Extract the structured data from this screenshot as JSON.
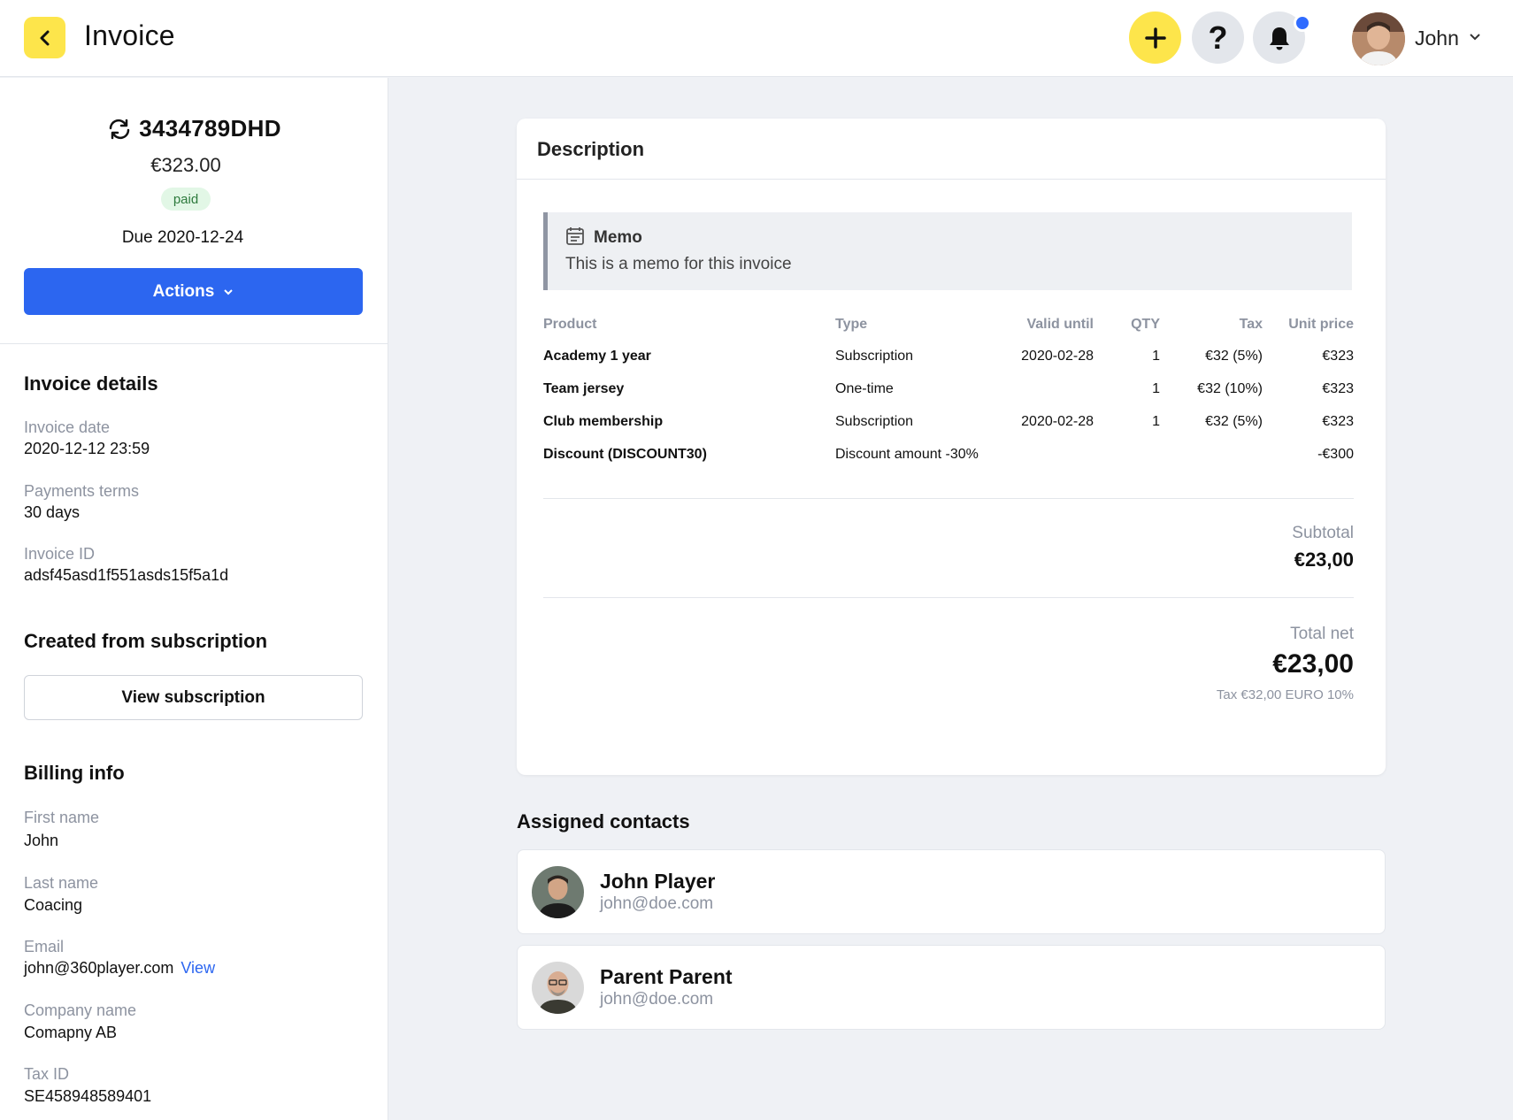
{
  "header": {
    "title": "Invoice",
    "user_name": "John",
    "colors": {
      "accent_yellow": "#fde54b",
      "notification_dot": "#2f6bff"
    }
  },
  "summary": {
    "invoice_number": "3434789DHD",
    "amount": "€323.00",
    "status": "paid",
    "due": "Due 2020-12-24",
    "actions_label": "Actions"
  },
  "invoice_details": {
    "heading": "Invoice details",
    "fields": [
      {
        "label": "Invoice date",
        "value": "2020-12-12 23:59"
      },
      {
        "label": "Payments terms",
        "value": "30 days"
      },
      {
        "label": "Invoice ID",
        "value": "adsf45asd1f551asds15f5a1d"
      }
    ]
  },
  "subscription": {
    "heading": "Created from subscription",
    "button_label": "View subscription"
  },
  "billing": {
    "heading": "Billing info",
    "fields": [
      {
        "label": "First name",
        "value": "John"
      },
      {
        "label": "Last name",
        "value": "Coacing"
      },
      {
        "label": "Email",
        "value": "john@360player.com",
        "link": "View"
      },
      {
        "label": "Company name",
        "value": "Comapny AB"
      },
      {
        "label": "Tax ID",
        "value": "SE458948589401"
      }
    ]
  },
  "description": {
    "title": "Description",
    "memo_title": "Memo",
    "memo_text": "This is a memo for this invoice",
    "columns": [
      "Product",
      "Type",
      "Valid until",
      "QTY",
      "Tax",
      "Unit price"
    ],
    "rows": [
      [
        "Academy 1 year",
        "Subscription",
        "2020-02-28",
        "1",
        "€32 (5%)",
        "€323"
      ],
      [
        "Team jersey",
        "One-time",
        "",
        "1",
        "€32 (10%)",
        "€323"
      ],
      [
        "Club membership",
        "Subscription",
        "2020-02-28",
        "1",
        "€32 (5%)",
        "€323"
      ],
      [
        "Discount (DISCOUNT30)",
        "Discount amount -30%",
        "",
        "",
        "",
        "-€300"
      ]
    ],
    "subtotal_label": "Subtotal",
    "subtotal_value": "€23,00",
    "total_label": "Total net",
    "total_value": "€23,00",
    "tax_note": "Tax €32,00 EURO 10%"
  },
  "contacts": {
    "heading": "Assigned contacts",
    "items": [
      {
        "name": "John Player",
        "email": "john@doe.com"
      },
      {
        "name": "Parent Parent",
        "email": "john@doe.com"
      }
    ]
  }
}
